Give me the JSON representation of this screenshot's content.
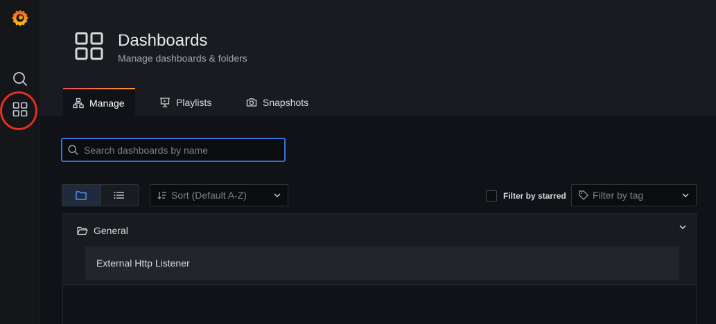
{
  "header": {
    "title": "Dashboards",
    "subtitle": "Manage dashboards & folders",
    "icon": "dashboards-icon"
  },
  "tabs": [
    {
      "label": "Manage",
      "icon": "sitemap-icon",
      "active": true
    },
    {
      "label": "Playlists",
      "icon": "presentation-icon",
      "active": false
    },
    {
      "label": "Snapshots",
      "icon": "camera-icon",
      "active": false
    }
  ],
  "search": {
    "placeholder": "Search dashboards by name",
    "value": ""
  },
  "toolbar": {
    "sort_placeholder": "Sort (Default A-Z)",
    "filter_starred_label": "Filter by starred",
    "filter_tag_placeholder": "Filter by tag"
  },
  "folders": [
    {
      "name": "General",
      "items": [
        {
          "title": "External Http Listener"
        }
      ]
    }
  ],
  "colors": {
    "accent_blue": "#3274d9",
    "highlight_ring": "#e52f22",
    "tab_gradient_start": "#f2495c",
    "tab_gradient_end": "#ff9830"
  }
}
